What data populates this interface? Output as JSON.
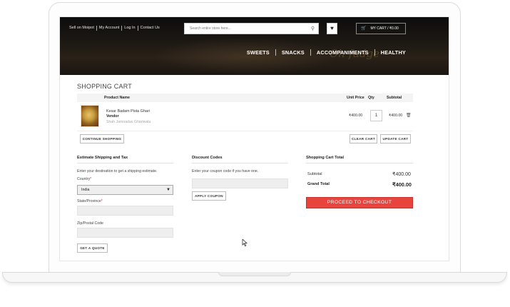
{
  "header": {
    "top_links": [
      "Sell on Moipot",
      "My Account",
      "Log In",
      "Contact Us"
    ],
    "search_placeholder": "Search entire store here...",
    "cart_label": "MY CART / ₹0.00",
    "nav": [
      "SWEETS",
      "SNACKS",
      "ACCOMPANIMENTS",
      "HEALTHY"
    ],
    "banner_text": "Oh fudge"
  },
  "page_title": "SHOPPING CART",
  "cart_table": {
    "columns": [
      "Product Name",
      "Unit Price",
      "Qty",
      "Subtotal"
    ],
    "rows": [
      {
        "name": "Kesar Badam Pista Ghari",
        "vendor_label": "Vendor",
        "vendor": "Shah Jamnadas Ghariwala",
        "unit_price": "₹400.00",
        "qty": "1",
        "subtotal": "₹400.00"
      }
    ]
  },
  "buttons": {
    "continue": "CONTINUE SHOPPING",
    "clear": "CLEAR CART",
    "update": "UPDATE CART",
    "quote": "GET A QUOTE",
    "coupon": "APPLY COUPON",
    "checkout": "PROCEED TO CHECKOUT"
  },
  "shipping": {
    "title": "Estimate Shipping and Tax",
    "intro": "Enter your destination to get a shipping estimate.",
    "country_label": "Country",
    "country_value": "India",
    "state_label": "State/Province",
    "zip_label": "Zip/Postal Code",
    "required_mark": "*"
  },
  "discount": {
    "title": "Discount Codes",
    "intro": "Enter your coupon code if you have one."
  },
  "totals": {
    "title": "Shopping Cart Total",
    "subtotal_label": "Subtotal",
    "subtotal_value": "₹400.00",
    "grand_label": "Grand Total",
    "grand_value": "₹400.00"
  },
  "colors": {
    "checkout_button": "#e8443e",
    "header_bg": "#1a1612"
  }
}
